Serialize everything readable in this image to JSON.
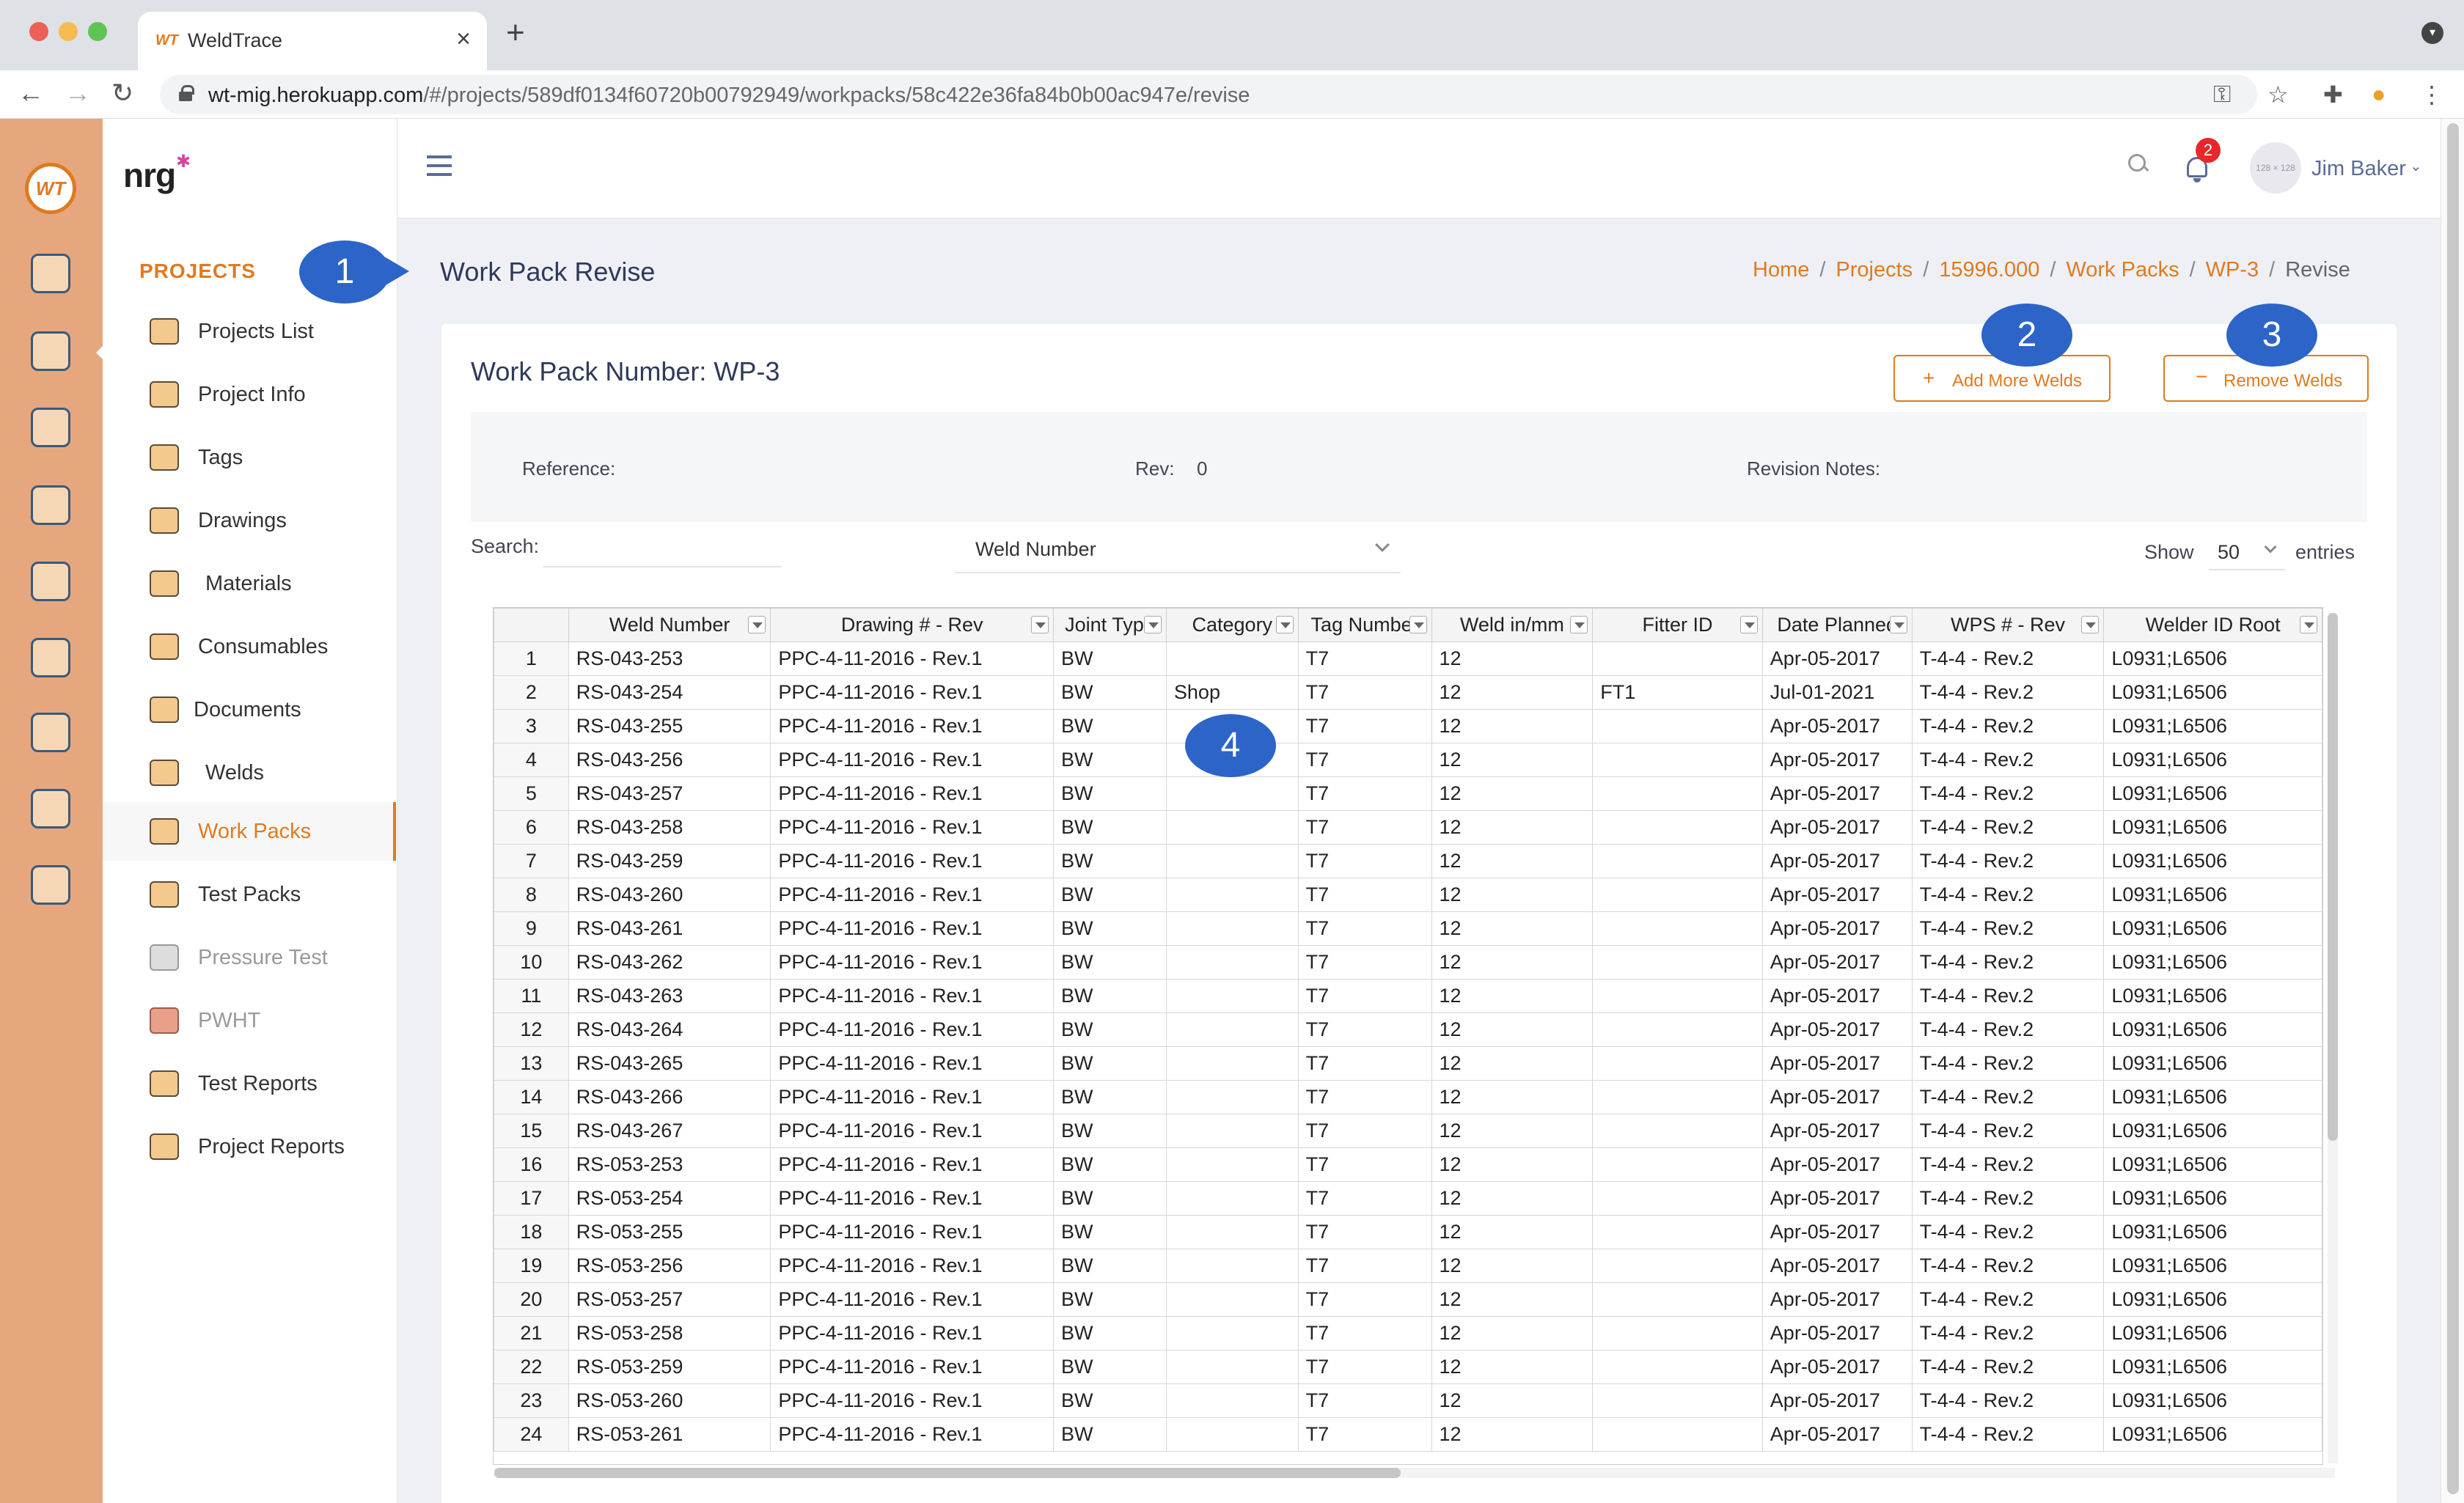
{
  "browser": {
    "tab_title": "WeldTrace",
    "tab_favicon": "WT",
    "url_host": "wt-mig.herokuapp.com",
    "url_path": "/#/projects/589df0134f60720b00792949/workpacks/58c422e36fa84b0b00ac947e/revise"
  },
  "rail": {
    "logo_text": "WT",
    "icons": [
      "monitor-icon",
      "folder-gear-icon",
      "clipboard-gear-icon",
      "welder-icon",
      "org-chart-icon",
      "whiteboard-icon",
      "team-icon",
      "checklist-icon",
      "badge-icon"
    ]
  },
  "sidenav": {
    "brand": "nrg",
    "heading": "PROJECTS",
    "items": [
      {
        "label": "Projects List",
        "icon": "camera-icon"
      },
      {
        "label": "Project Info",
        "icon": "gears-icon"
      },
      {
        "label": "Tags",
        "icon": "tag-icon"
      },
      {
        "label": "Drawings",
        "icon": "drawing-icon"
      },
      {
        "label": "Materials",
        "icon": "materials-icon"
      },
      {
        "label": "Consumables",
        "icon": "consumables-icon"
      },
      {
        "label": "Documents",
        "icon": "folder-icon"
      },
      {
        "label": "Welds",
        "icon": "weld-icon"
      },
      {
        "label": "Work Packs",
        "icon": "work-pack-icon"
      },
      {
        "label": "Test Packs",
        "icon": "radiation-icon"
      },
      {
        "label": "Pressure Test",
        "icon": "pressure-gauge-icon"
      },
      {
        "label": "PWHT",
        "icon": "heater-icon"
      },
      {
        "label": "Test Reports",
        "icon": "report-icon"
      },
      {
        "label": "Project Reports",
        "icon": "project-report-icon"
      }
    ]
  },
  "header": {
    "notification_count": "2",
    "avatar_text": "128 × 128",
    "user_name": "Jim Baker"
  },
  "page": {
    "title": "Work Pack Revise",
    "breadcrumb": [
      "Home",
      "Projects",
      "15996.000",
      "Work Packs",
      "WP-3"
    ],
    "breadcrumb_current": "Revise"
  },
  "markers": [
    "1",
    "2",
    "3",
    "4"
  ],
  "card": {
    "title": "Work Pack Number: WP-3",
    "add_label": "Add More Welds",
    "remove_label": "Remove Welds",
    "reference_label": "Reference:",
    "reference_value": "",
    "rev_label": "Rev:",
    "rev_value": "0",
    "notes_label": "Revision Notes:",
    "notes_value": "",
    "search_label": "Search:",
    "search_value": "",
    "search_column": "Weld Number",
    "show_label": "Show",
    "show_value": "50",
    "entries_label": "entries"
  },
  "table": {
    "columns": [
      "",
      "Weld Number",
      "Drawing # - Rev",
      "Joint Type",
      "Category",
      "Tag Number",
      "Weld in/mm",
      "Fitter ID",
      "Date Planned",
      "WPS # - Rev",
      "Welder ID Root"
    ],
    "rows": [
      [
        "1",
        "RS-043-253",
        "PPC-4-11-2016 - Rev.1",
        "BW",
        "",
        "T7",
        "12",
        "",
        "Apr-05-2017",
        "T-4-4 - Rev.2",
        "L0931;L6506"
      ],
      [
        "2",
        "RS-043-254",
        "PPC-4-11-2016 - Rev.1",
        "BW",
        "Shop",
        "T7",
        "12",
        "FT1",
        "Jul-01-2021",
        "T-4-4 - Rev.2",
        "L0931;L6506"
      ],
      [
        "3",
        "RS-043-255",
        "PPC-4-11-2016 - Rev.1",
        "BW",
        "",
        "T7",
        "12",
        "",
        "Apr-05-2017",
        "T-4-4 - Rev.2",
        "L0931;L6506"
      ],
      [
        "4",
        "RS-043-256",
        "PPC-4-11-2016 - Rev.1",
        "BW",
        "",
        "T7",
        "12",
        "",
        "Apr-05-2017",
        "T-4-4 - Rev.2",
        "L0931;L6506"
      ],
      [
        "5",
        "RS-043-257",
        "PPC-4-11-2016 - Rev.1",
        "BW",
        "",
        "T7",
        "12",
        "",
        "Apr-05-2017",
        "T-4-4 - Rev.2",
        "L0931;L6506"
      ],
      [
        "6",
        "RS-043-258",
        "PPC-4-11-2016 - Rev.1",
        "BW",
        "",
        "T7",
        "12",
        "",
        "Apr-05-2017",
        "T-4-4 - Rev.2",
        "L0931;L6506"
      ],
      [
        "7",
        "RS-043-259",
        "PPC-4-11-2016 - Rev.1",
        "BW",
        "",
        "T7",
        "12",
        "",
        "Apr-05-2017",
        "T-4-4 - Rev.2",
        "L0931;L6506"
      ],
      [
        "8",
        "RS-043-260",
        "PPC-4-11-2016 - Rev.1",
        "BW",
        "",
        "T7",
        "12",
        "",
        "Apr-05-2017",
        "T-4-4 - Rev.2",
        "L0931;L6506"
      ],
      [
        "9",
        "RS-043-261",
        "PPC-4-11-2016 - Rev.1",
        "BW",
        "",
        "T7",
        "12",
        "",
        "Apr-05-2017",
        "T-4-4 - Rev.2",
        "L0931;L6506"
      ],
      [
        "10",
        "RS-043-262",
        "PPC-4-11-2016 - Rev.1",
        "BW",
        "",
        "T7",
        "12",
        "",
        "Apr-05-2017",
        "T-4-4 - Rev.2",
        "L0931;L6506"
      ],
      [
        "11",
        "RS-043-263",
        "PPC-4-11-2016 - Rev.1",
        "BW",
        "",
        "T7",
        "12",
        "",
        "Apr-05-2017",
        "T-4-4 - Rev.2",
        "L0931;L6506"
      ],
      [
        "12",
        "RS-043-264",
        "PPC-4-11-2016 - Rev.1",
        "BW",
        "",
        "T7",
        "12",
        "",
        "Apr-05-2017",
        "T-4-4 - Rev.2",
        "L0931;L6506"
      ],
      [
        "13",
        "RS-043-265",
        "PPC-4-11-2016 - Rev.1",
        "BW",
        "",
        "T7",
        "12",
        "",
        "Apr-05-2017",
        "T-4-4 - Rev.2",
        "L0931;L6506"
      ],
      [
        "14",
        "RS-043-266",
        "PPC-4-11-2016 - Rev.1",
        "BW",
        "",
        "T7",
        "12",
        "",
        "Apr-05-2017",
        "T-4-4 - Rev.2",
        "L0931;L6506"
      ],
      [
        "15",
        "RS-043-267",
        "PPC-4-11-2016 - Rev.1",
        "BW",
        "",
        "T7",
        "12",
        "",
        "Apr-05-2017",
        "T-4-4 - Rev.2",
        "L0931;L6506"
      ],
      [
        "16",
        "RS-053-253",
        "PPC-4-11-2016 - Rev.1",
        "BW",
        "",
        "T7",
        "12",
        "",
        "Apr-05-2017",
        "T-4-4 - Rev.2",
        "L0931;L6506"
      ],
      [
        "17",
        "RS-053-254",
        "PPC-4-11-2016 - Rev.1",
        "BW",
        "",
        "T7",
        "12",
        "",
        "Apr-05-2017",
        "T-4-4 - Rev.2",
        "L0931;L6506"
      ],
      [
        "18",
        "RS-053-255",
        "PPC-4-11-2016 - Rev.1",
        "BW",
        "",
        "T7",
        "12",
        "",
        "Apr-05-2017",
        "T-4-4 - Rev.2",
        "L0931;L6506"
      ],
      [
        "19",
        "RS-053-256",
        "PPC-4-11-2016 - Rev.1",
        "BW",
        "",
        "T7",
        "12",
        "",
        "Apr-05-2017",
        "T-4-4 - Rev.2",
        "L0931;L6506"
      ],
      [
        "20",
        "RS-053-257",
        "PPC-4-11-2016 - Rev.1",
        "BW",
        "",
        "T7",
        "12",
        "",
        "Apr-05-2017",
        "T-4-4 - Rev.2",
        "L0931;L6506"
      ],
      [
        "21",
        "RS-053-258",
        "PPC-4-11-2016 - Rev.1",
        "BW",
        "",
        "T7",
        "12",
        "",
        "Apr-05-2017",
        "T-4-4 - Rev.2",
        "L0931;L6506"
      ],
      [
        "22",
        "RS-053-259",
        "PPC-4-11-2016 - Rev.1",
        "BW",
        "",
        "T7",
        "12",
        "",
        "Apr-05-2017",
        "T-4-4 - Rev.2",
        "L0931;L6506"
      ],
      [
        "23",
        "RS-053-260",
        "PPC-4-11-2016 - Rev.1",
        "BW",
        "",
        "T7",
        "12",
        "",
        "Apr-05-2017",
        "T-4-4 - Rev.2",
        "L0931;L6506"
      ],
      [
        "24",
        "RS-053-261",
        "PPC-4-11-2016 - Rev.1",
        "BW",
        "",
        "T7",
        "12",
        "",
        "Apr-05-2017",
        "T-4-4 - Rev.2",
        "L0931;L6506"
      ]
    ]
  }
}
